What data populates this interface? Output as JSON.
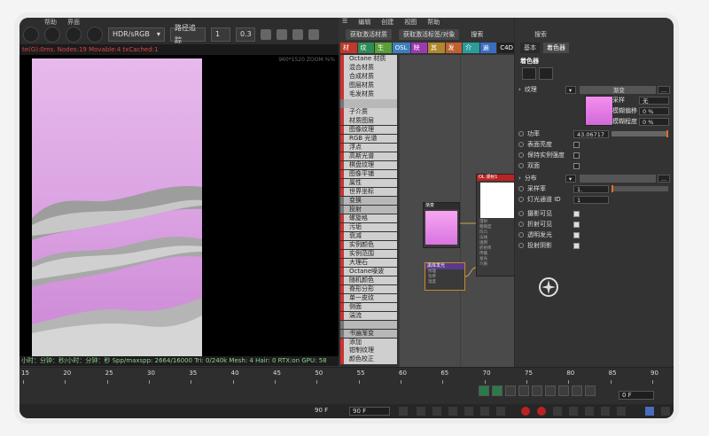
{
  "render_view": {
    "menu": [
      "te(G):0ms",
      "帮助",
      "界面"
    ],
    "toolbar": {
      "color_mode": "HDR/sRGB",
      "path_label": "路径追踪",
      "frame_value": "1",
      "exposure": "0.3"
    },
    "status_top": "te(G):0ms. Nodes:19 Movable:4 txCached:1",
    "zoom": "960*1520 ZOOM:%%",
    "status_bottom": "小时：分钟：秒/小时：分钟：秒   Spp/maxspp: 2664/16000   Tri: 0/240k   Mesh: 4   Hair: 0   RTX:on   GPU: 58"
  },
  "node_editor": {
    "menu": [
      "编辑",
      "创建",
      "视图",
      "帮助"
    ],
    "actions": [
      "获取激活材质",
      "获取激活标签/对象",
      "搜索"
    ],
    "tabs": [
      {
        "label": "材质",
        "color": "#c0392b"
      },
      {
        "label": "纹理",
        "color": "#2e8b57"
      },
      {
        "label": "生成",
        "color": "#5a9e3a"
      },
      {
        "label": "OSL",
        "color": "#3d7ebd"
      },
      {
        "label": "映射",
        "color": "#9b3ab0"
      },
      {
        "label": "其他",
        "color": "#b0862e"
      },
      {
        "label": "发光",
        "color": "#c06030"
      },
      {
        "label": "介质",
        "color": "#2a9c9c"
      },
      {
        "label": "遍历",
        "color": "#3a6ec0"
      },
      {
        "label": "C4D",
        "color": "#222222"
      }
    ],
    "list": [
      {
        "label": "Octane 材质",
        "cat": false
      },
      {
        "label": "混合材质",
        "cat": false
      },
      {
        "label": "合成材质",
        "cat": false
      },
      {
        "label": "图层材质",
        "cat": false
      },
      {
        "label": "毛发材质",
        "cat": false
      },
      {
        "label": "",
        "cat": true
      },
      {
        "label": "子介质",
        "cat": false
      },
      {
        "label": "材质图层",
        "cat": false
      },
      {
        "label": "图像纹理",
        "cat": false
      },
      {
        "label": "RGB 光谱",
        "cat": false
      },
      {
        "label": "浮点",
        "cat": false
      },
      {
        "label": "高斯光谱",
        "cat": false
      },
      {
        "label": "棋盘纹理",
        "cat": false
      },
      {
        "label": "图像平铺",
        "cat": false
      },
      {
        "label": "属性",
        "cat": false
      },
      {
        "label": "世界坐标",
        "cat": false
      },
      {
        "label": "变换",
        "cat": true
      },
      {
        "label": "投射",
        "cat": true
      },
      {
        "label": "螺旋格",
        "cat": false
      },
      {
        "label": "污垢",
        "cat": false
      },
      {
        "label": "衰减",
        "cat": false
      },
      {
        "label": "实例颜色",
        "cat": false
      },
      {
        "label": "实例范围",
        "cat": false
      },
      {
        "label": "大理石",
        "cat": false
      },
      {
        "label": "Octane噪波",
        "cat": false
      },
      {
        "label": "随机颜色",
        "cat": false
      },
      {
        "label": "脊形分形",
        "cat": false
      },
      {
        "label": "单一皮纹",
        "cat": false
      },
      {
        "label": "侧面",
        "cat": false
      },
      {
        "label": "湍流",
        "cat": false
      },
      {
        "label": "",
        "cat": true
      },
      {
        "label": "书遍渐变",
        "cat": true
      },
      {
        "label": "添加",
        "cat": false
      },
      {
        "label": "钳制纹理",
        "cat": false
      },
      {
        "label": "颜色校正",
        "cat": false
      }
    ],
    "nodes": {
      "gradient": {
        "title": "渐变"
      },
      "diffuse": {
        "title": "OL 漫射1",
        "rows": [
          "漫射",
          "粗糙度",
          "凹凸",
          "法线",
          "透明",
          "折射率",
          "传输",
          "发光",
          "介质"
        ]
      },
      "blackbody": {
        "title": "黑体发光",
        "rows": [
          "纹理",
          "功率",
          "温度",
          "归一化"
        ]
      }
    }
  },
  "attributes": {
    "search": "搜索",
    "tabs": [
      "基本",
      "着色器"
    ],
    "section": "着色器",
    "texture_label": "纹理",
    "texture_value": "渐变",
    "sampler": "采样",
    "sampler_value": "无",
    "blur_offset_label": "模糊偏移",
    "blur_offset_value": "0 %",
    "blur_level_label": "模糊程度",
    "blur_level_value": "0 %",
    "power_label": "功率",
    "power_value": "43.06717",
    "surface_brightness": "表面亮度",
    "keep_instance": "保持实例强度",
    "double_sided": "双面",
    "distribution": "分布",
    "sample_rate_label": "采样率",
    "sample_rate_value": "1.",
    "light_pass_label": "灯光通道 ID",
    "light_pass_value": "1",
    "camera_visible": "摄影可见",
    "refract_visible": "折射可见",
    "transparent_emit": "透明发光",
    "shadow_cast": "投射阴影"
  },
  "timeline": {
    "ticks": [
      "15",
      "20",
      "25",
      "30",
      "35",
      "40",
      "45",
      "50",
      "55",
      "60",
      "65",
      "70",
      "75",
      "80",
      "85",
      "90"
    ],
    "current_frame": "0 F",
    "start_frame": "90 F",
    "end_frame": "90 F"
  },
  "colors": {
    "accent": "#e07020",
    "panel": "#333333",
    "canvas_top": "#e7b9ec",
    "canvas_bottom": "#cc86d6"
  }
}
